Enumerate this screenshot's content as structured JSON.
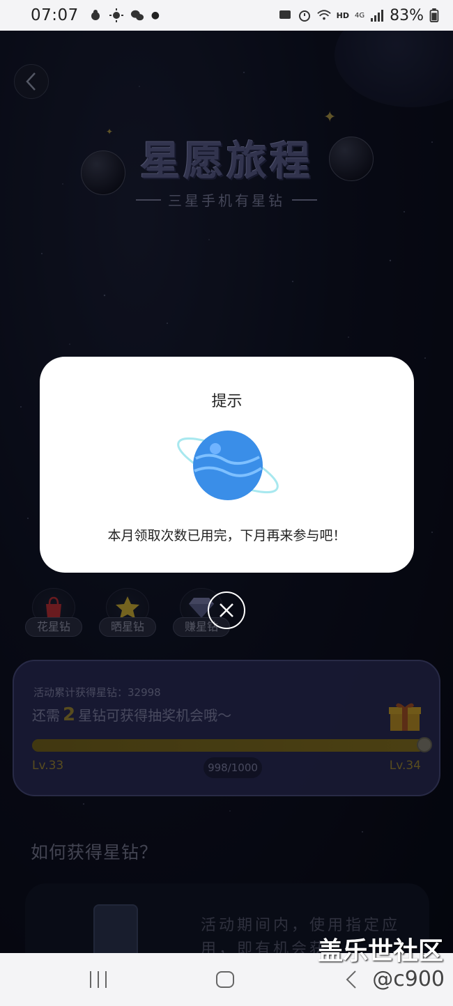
{
  "status_bar": {
    "time": "07:07",
    "battery": "83%",
    "network": "HD",
    "signal_type": "4G"
  },
  "header": {
    "title": "星愿旅程",
    "subtitle": "三星手机有星钻"
  },
  "actions": [
    {
      "label": "花星钻",
      "icon": "shopping-bag-icon"
    },
    {
      "label": "晒星钻",
      "icon": "star-icon"
    },
    {
      "label": "赚星钻",
      "icon": "diamond-icon"
    }
  ],
  "progress_card": {
    "total_label": "活动累计获得星钻：32998",
    "need_prefix": "还需",
    "need_value": "2",
    "need_suffix": "星钻可获得抽奖机会哦～",
    "progress_fraction": 0.998,
    "progress_text": "998/1000",
    "level_start": "Lv.33",
    "level_end": "Lv.34"
  },
  "howto": {
    "title": "如何获得星钻？",
    "text": "活动期间内，使用指定应用，即有机会获"
  },
  "modal": {
    "title": "提示",
    "message": "本月领取次数已用完，下月再来参与吧！"
  },
  "watermark": {
    "line1": "盖乐世社区",
    "line2": "@c900"
  },
  "colors": {
    "accent_gold": "#a8913a",
    "card_bg": "#2c2e5c",
    "planet_blue": "#3a8ee8"
  }
}
